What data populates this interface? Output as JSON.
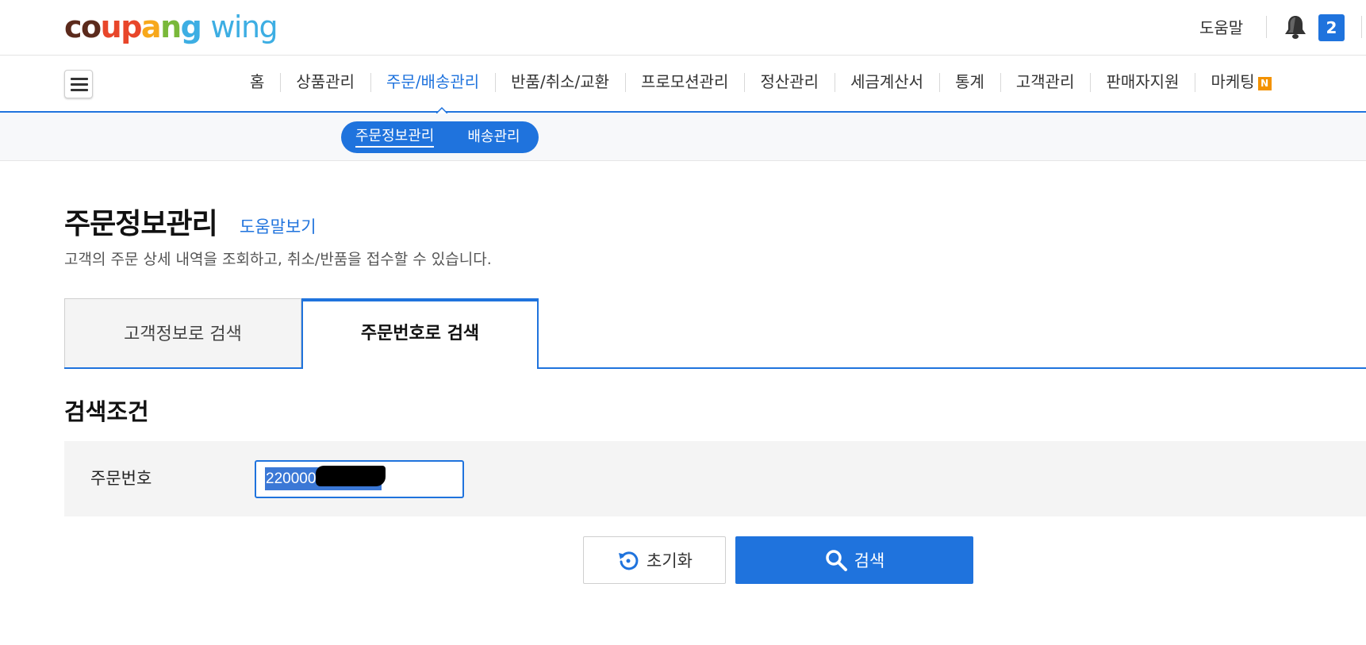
{
  "header": {
    "logo": {
      "parts": [
        "c",
        "o",
        "u",
        "p",
        "a",
        "n",
        "g"
      ],
      "wing": "wing"
    },
    "help_label": "도움말",
    "notification_count": "2",
    "colors": {
      "accent": "#1f73dd",
      "new_badge": "#f39200"
    }
  },
  "nav": {
    "items": [
      {
        "label": "홈"
      },
      {
        "label": "상품관리"
      },
      {
        "label": "주문/배송관리"
      },
      {
        "label": "반품/취소/교환"
      },
      {
        "label": "프로모션관리"
      },
      {
        "label": "정산관리"
      },
      {
        "label": "세금계산서"
      },
      {
        "label": "통계"
      },
      {
        "label": "고객관리"
      },
      {
        "label": "판매자지원"
      },
      {
        "label": "마케팅"
      }
    ],
    "new_badge": "N"
  },
  "subnav": {
    "items": [
      {
        "label": "주문정보관리"
      },
      {
        "label": "배송관리"
      }
    ]
  },
  "page": {
    "title": "주문정보관리",
    "help_link": "도움말보기",
    "description": "고객의 주문 상세 내역을 조회하고, 취소/반품을 접수할 수 있습니다."
  },
  "tabs": [
    {
      "label": "고객정보로 검색"
    },
    {
      "label": "주문번호로 검색"
    }
  ],
  "search": {
    "section_title": "검색조건",
    "order_number_label": "주문번호",
    "order_number_value": "220000"
  },
  "buttons": {
    "reset_label": "초기화",
    "search_label": "검색"
  }
}
